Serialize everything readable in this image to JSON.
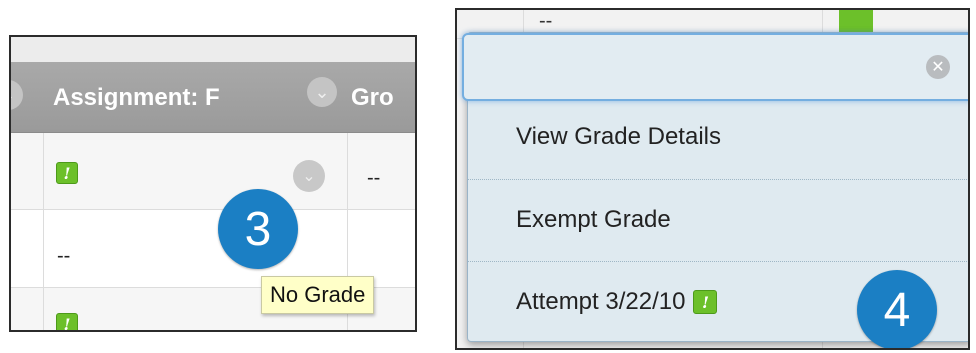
{
  "left_panel": {
    "columns": [
      "Assignment: F",
      "Gro"
    ],
    "rows": [
      {
        "icon": "needs-grading-icon",
        "group_value": "--"
      },
      {
        "value": "--"
      },
      {
        "icon": "needs-grading-icon"
      }
    ],
    "step_number": "3",
    "tooltip": "No Grade"
  },
  "right_panel": {
    "background_value": "--",
    "menu_items": [
      "View Grade Details",
      "Exempt Grade",
      "Attempt 3/22/10"
    ],
    "step_number": "4"
  },
  "icons": {
    "needs_grading": "!",
    "chevron": "⌄",
    "close": "✕"
  },
  "colors": {
    "accent_blue": "#1b7fc4",
    "needs_grading_green": "#6cc02a",
    "tooltip_bg": "#ffffc8",
    "menu_bg": "#dfeaf0"
  }
}
